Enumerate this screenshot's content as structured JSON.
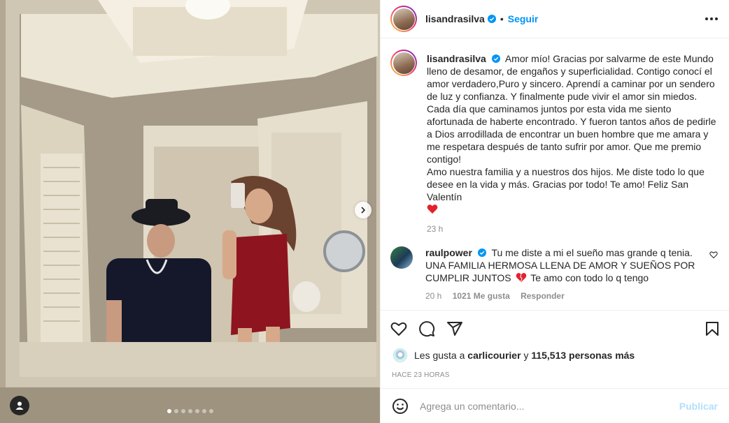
{
  "post": {
    "username": "lisandrasilva",
    "separator": "•",
    "follow_label": "Seguir",
    "more_icon": "more-horizontal-icon",
    "caption_text": "Amor mío! Gracias por salvarme de este Mundo lleno de desamor, de engaños y superficialidad. Contigo conocí el amor verdadero,Puro y sincero. Aprendí a caminar por un sendero de luz y confianza. Y finalmente pude vivir el amor sin miedos. Cada día que caminamos juntos por esta vida me siento afortunada de haberte encontrado. Y fueron tantos años de pedirle a Dios arrodillada de encontrar un buen hombre que me amara y me respetara después de tanto sufrir por amor. Que me premio contigo!",
    "caption_text_2": "Amo nuestra familia y a nuestros dos hijos. Me diste todo lo que desee en la vida y más. Gracias por todo! Te amo! Feliz San Valentín",
    "caption_time": "23 h",
    "carousel_total": 7,
    "carousel_active": 1
  },
  "comment": {
    "username": "raulpower",
    "text": "Tu me diste a mi el sueño mas grande q tenia. UNA FAMILIA HERMOSA LLENA DE AMOR Y SUEÑOS POR CUMPLIR JUNTOS",
    "text_after": "Te amo con todo lo q tengo",
    "time": "20 h",
    "likes": "1021 Me gusta",
    "reply_label": "Responder"
  },
  "likes": {
    "prefix": "Les gusta a",
    "user": "carlicourier",
    "connector": "y",
    "others": "115,513 personas más"
  },
  "timestamp": "HACE 23 HORAS",
  "add_comment": {
    "placeholder": "Agrega un comentario...",
    "publish_label": "Publicar"
  },
  "colors": {
    "accent": "#0095f6",
    "publish_disabled": "#b2dffc",
    "heart": "#ed4956",
    "text": "#262626",
    "muted": "#8e8e8e"
  },
  "icons": [
    "verified-badge-icon",
    "heart-icon",
    "comment-icon",
    "share-icon",
    "bookmark-icon",
    "emoji-icon",
    "chevron-right-icon",
    "user-tag-icon",
    "red-heart-emoji-icon"
  ]
}
